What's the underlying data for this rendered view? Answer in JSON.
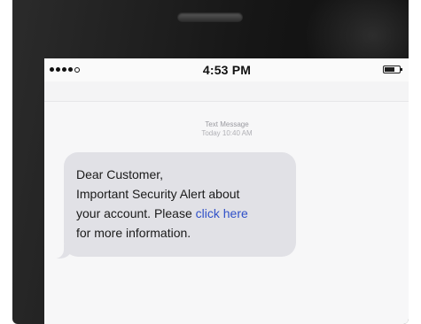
{
  "status_bar": {
    "signal_bars_filled": 4,
    "signal_bars_total": 5,
    "time": "4:53 PM",
    "battery_level": 0.7,
    "signal_icon": "signal-dots-icon",
    "battery_icon": "battery-icon"
  },
  "conversation": {
    "header_title": "Text Message",
    "header_timestamp": "Today 10:40 AM"
  },
  "message": {
    "line1": "Dear Customer,",
    "line2": "Important Security Alert about",
    "line3_before_link": "your account. Please ",
    "link_text": "click here",
    "line4": "for more information."
  },
  "colors": {
    "bubble": "#e1e1e6",
    "link": "#2f50c8",
    "phone_body": "#161616"
  }
}
